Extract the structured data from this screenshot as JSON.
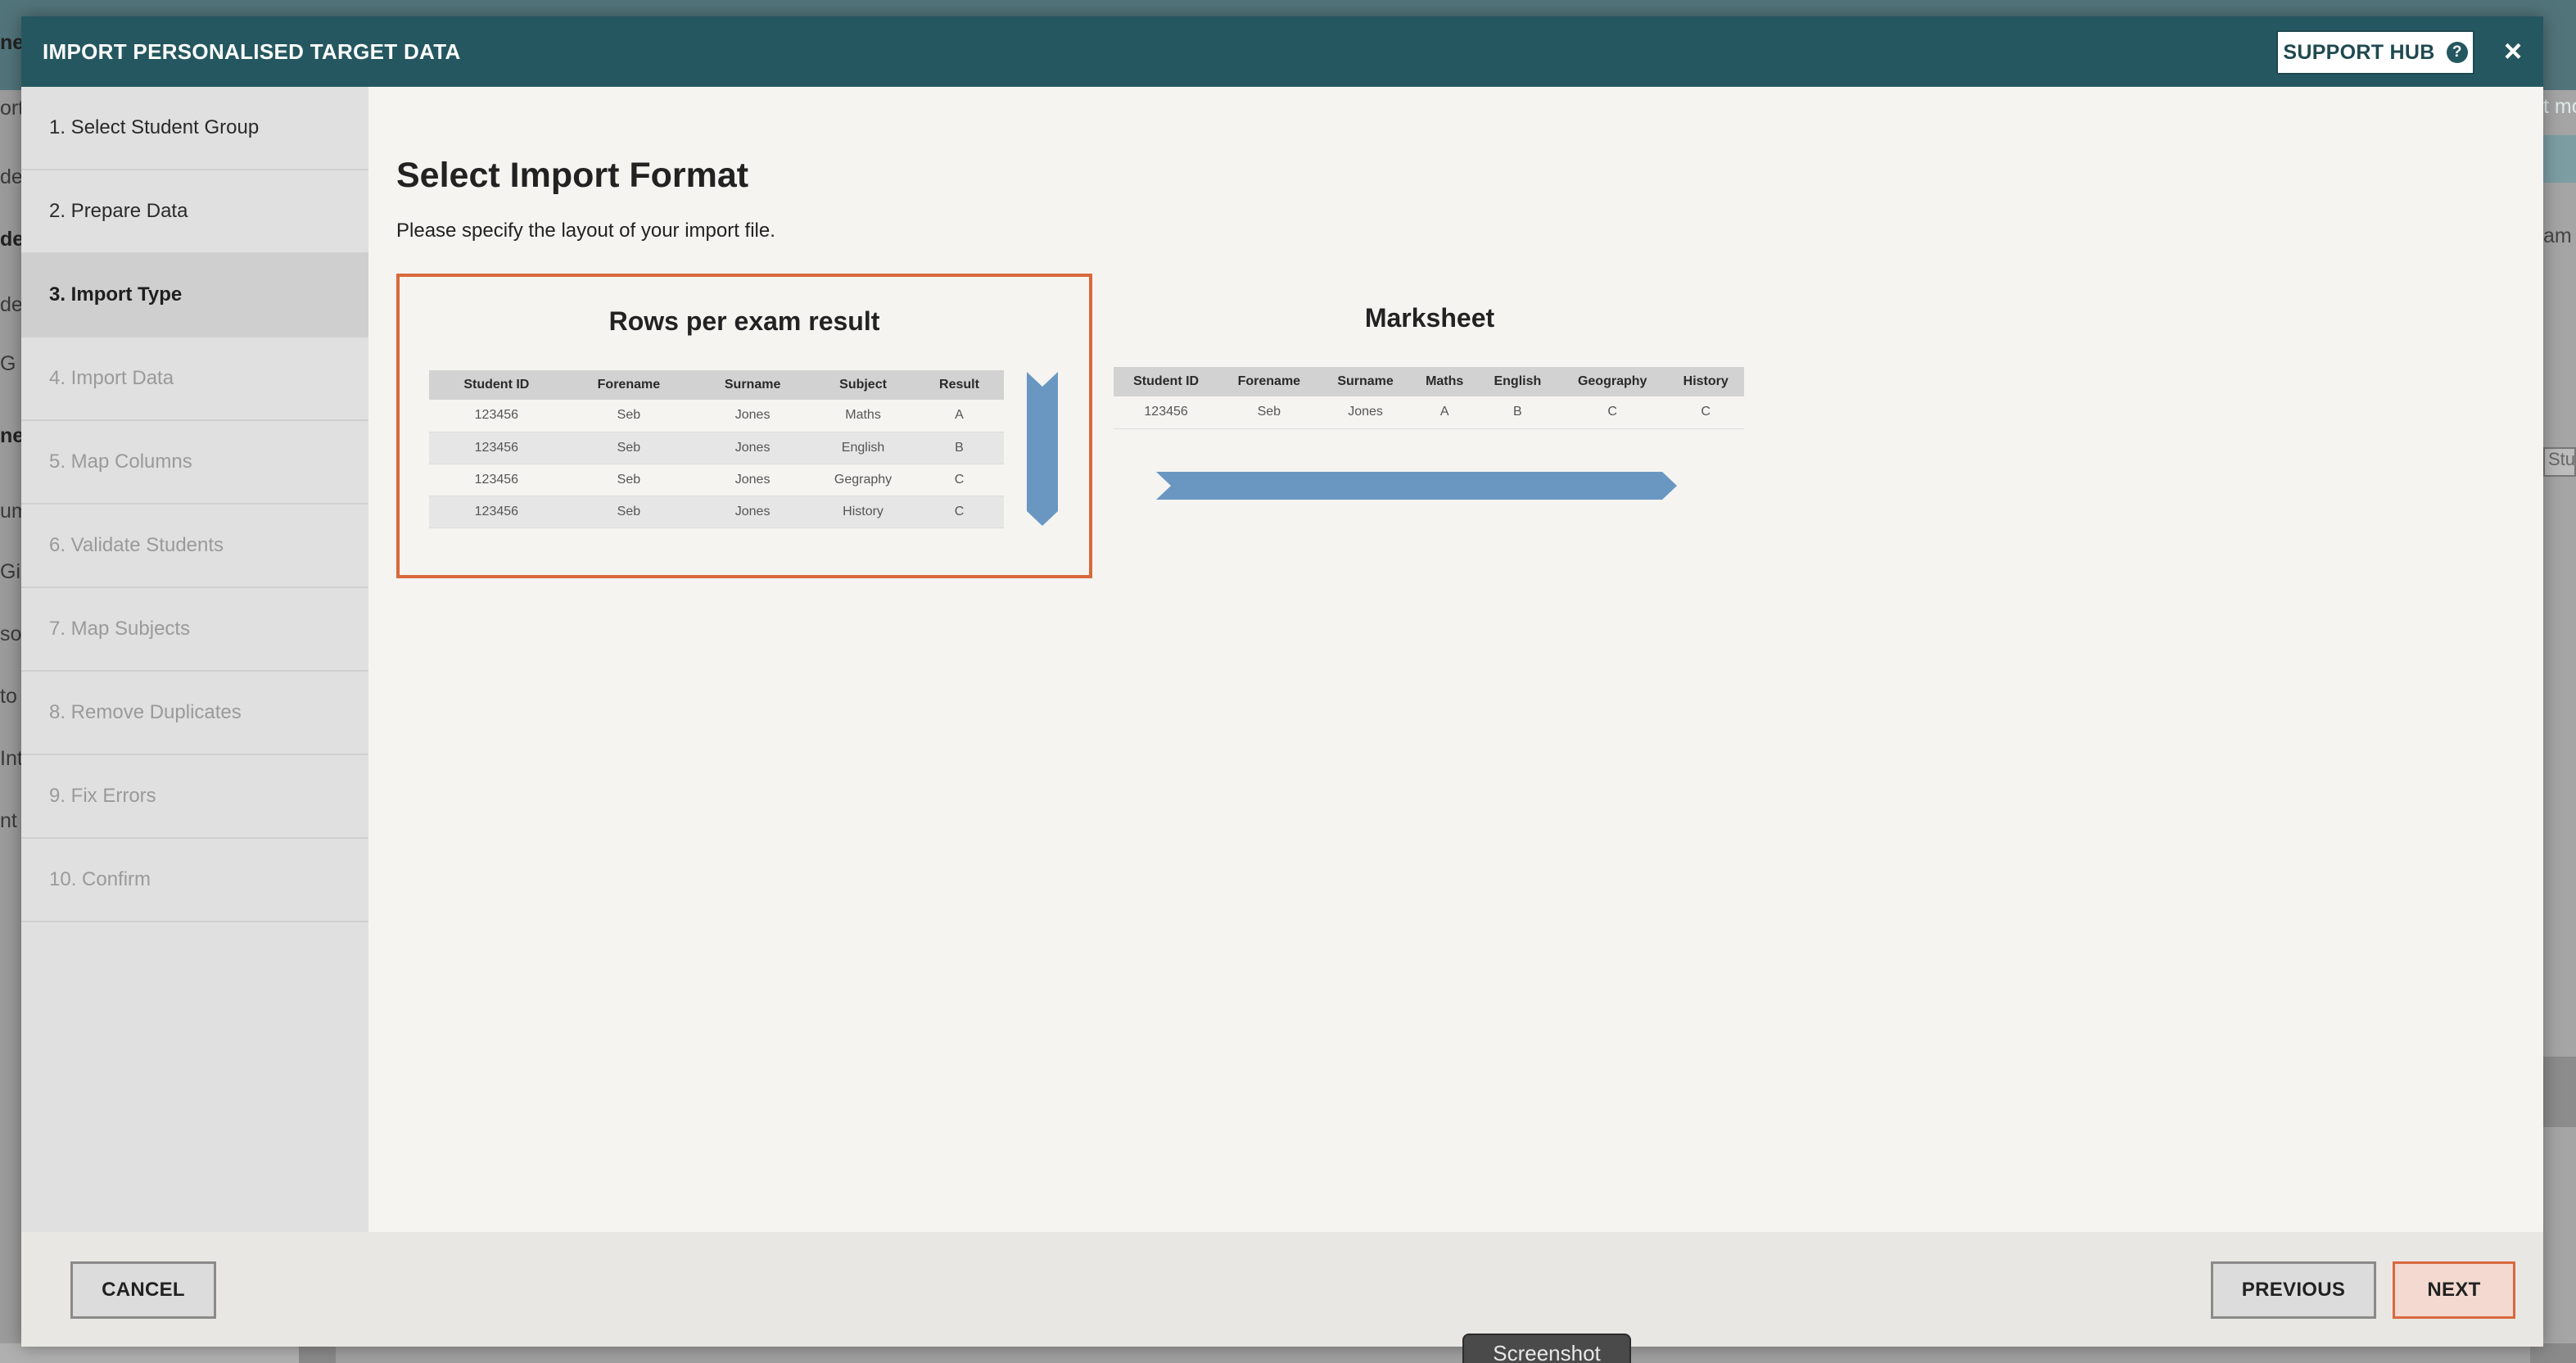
{
  "background": {
    "left_fragments": [
      "ne",
      "ort",
      "dep",
      "de",
      "des",
      "G R",
      "ne",
      "um",
      "Gi",
      "so",
      "to",
      "Int",
      "nt V"
    ],
    "right_fragments": [
      "t mo",
      "am R",
      "Stu"
    ]
  },
  "modal": {
    "title": "IMPORT PERSONALISED TARGET DATA",
    "support_hub_label": "SUPPORT HUB",
    "help_icon": "?",
    "close_icon": "×"
  },
  "steps": [
    {
      "label": "1. Select Student Group",
      "state": "done"
    },
    {
      "label": "2. Prepare Data",
      "state": "done"
    },
    {
      "label": "3. Import Type",
      "state": "active"
    },
    {
      "label": "4. Import Data",
      "state": "pending"
    },
    {
      "label": "5. Map Columns",
      "state": "pending"
    },
    {
      "label": "6. Validate Students",
      "state": "pending"
    },
    {
      "label": "7. Map Subjects",
      "state": "pending"
    },
    {
      "label": "8. Remove Duplicates",
      "state": "pending"
    },
    {
      "label": "9. Fix Errors",
      "state": "pending"
    },
    {
      "label": "10. Confirm",
      "state": "pending"
    }
  ],
  "main": {
    "title": "Select Import Format",
    "description": "Please specify the layout of your import file."
  },
  "formats": {
    "rows": {
      "title": "Rows per exam result",
      "selected": true,
      "headers": [
        "Student ID",
        "Forename",
        "Surname",
        "Subject",
        "Result"
      ],
      "rows": [
        [
          "123456",
          "Seb",
          "Jones",
          "Maths",
          "A"
        ],
        [
          "123456",
          "Seb",
          "Jones",
          "English",
          "B"
        ],
        [
          "123456",
          "Seb",
          "Jones",
          "Gegraphy",
          "C"
        ],
        [
          "123456",
          "Seb",
          "Jones",
          "History",
          "C"
        ]
      ],
      "arrow_direction": "down"
    },
    "marksheet": {
      "title": "Marksheet",
      "selected": false,
      "headers": [
        "Student ID",
        "Forename",
        "Surname",
        "Maths",
        "English",
        "Geography",
        "History"
      ],
      "rows": [
        [
          "123456",
          "Seb",
          "Jones",
          "A",
          "B",
          "C",
          "C"
        ]
      ],
      "arrow_direction": "right"
    }
  },
  "footer": {
    "cancel_label": "CANCEL",
    "previous_label": "PREVIOUS",
    "next_label": "NEXT"
  },
  "tooltip": {
    "label": "Screenshot"
  },
  "colors": {
    "header": "#255760",
    "accent": "#d8693d",
    "arrow": "#6a97c2"
  }
}
